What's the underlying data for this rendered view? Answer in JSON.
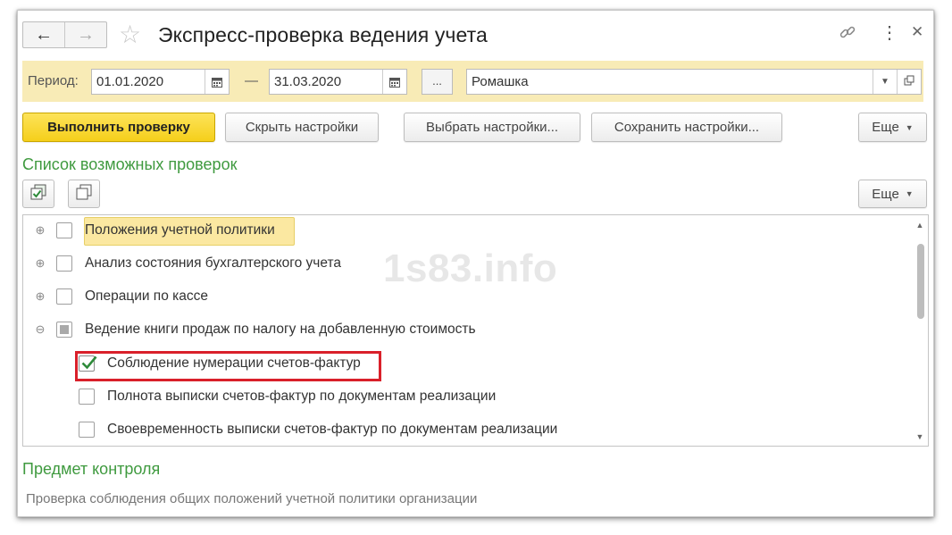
{
  "window": {
    "title": "Экспресс-проверка ведения учета",
    "nav": {
      "back_icon": "arrow-left-icon",
      "forward_icon": "arrow-right-icon"
    },
    "favorite_icon": "star-icon",
    "link_icon": "link-icon",
    "menu_icon": "more-vertical-icon",
    "close_icon": "close-icon"
  },
  "period": {
    "label": "Период:",
    "from": "01.01.2020",
    "separator": "—",
    "to": "31.03.2020",
    "select_button": "...",
    "organization": "Ромашка"
  },
  "toolbar": {
    "run": "Выполнить проверку",
    "hide_settings": "Скрыть настройки",
    "choose_settings": "Выбрать настройки...",
    "save_settings": "Сохранить настройки...",
    "more": "Еще"
  },
  "checks_section": {
    "title": "Список возможных проверок",
    "more": "Еще",
    "items": [
      {
        "label": "Положения учетной политики",
        "state": "unchecked",
        "expander": "plus",
        "level": 0,
        "highlighted": true
      },
      {
        "label": "Анализ состояния бухгалтерского учета",
        "state": "unchecked",
        "expander": "plus",
        "level": 0
      },
      {
        "label": "Операции по кассе",
        "state": "unchecked",
        "expander": "plus",
        "level": 0
      },
      {
        "label": "Ведение книги продаж по налогу на добавленную стоимость",
        "state": "partial",
        "expander": "minus",
        "level": 0
      },
      {
        "label": "Соблюдение нумерации счетов-фактур",
        "state": "checked",
        "level": 1,
        "framed": true
      },
      {
        "label": "Полнота выписки счетов-фактур по документам реализации",
        "state": "unchecked",
        "level": 1
      },
      {
        "label": "Своевременность выписки счетов-фактур по документам реализации",
        "state": "unchecked",
        "level": 1
      }
    ]
  },
  "subject": {
    "title": "Предмет контроля",
    "text": "Проверка соблюдения общих положений учетной политики организации"
  },
  "watermark": "1s83.info",
  "colors": {
    "accent_green": "#3f9a3f",
    "primary_button": "#f5cf1a",
    "period_bar": "#f8ebb6",
    "frame_red": "#d9202a",
    "check_green": "#2e8b3a"
  }
}
